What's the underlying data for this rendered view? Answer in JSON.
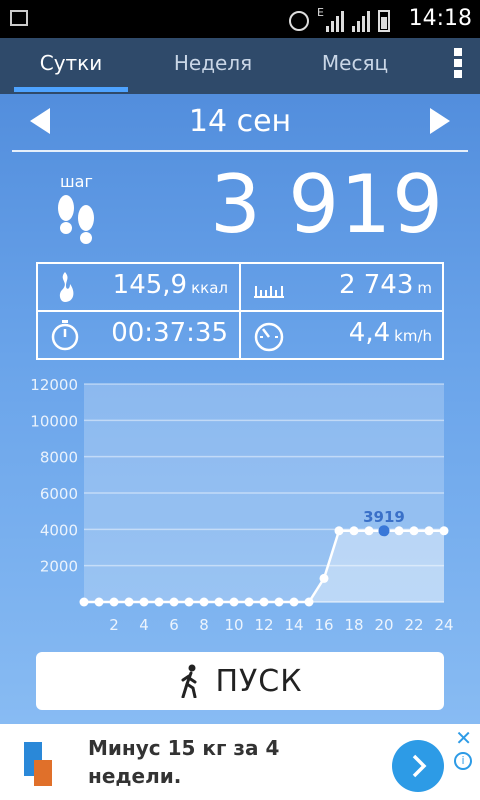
{
  "status": {
    "time": "14:18",
    "network": "E"
  },
  "tabs": [
    {
      "label": "Сутки",
      "active": true
    },
    {
      "label": "Неделя",
      "active": false
    },
    {
      "label": "Месяц",
      "active": false
    }
  ],
  "date": "14 сен",
  "steps": {
    "label": "шаг",
    "value": "3 919"
  },
  "stats": {
    "calories": {
      "value": "145,9",
      "unit": "ккал"
    },
    "distance": {
      "value": "2 743",
      "unit": "m"
    },
    "duration": {
      "value": "00:37:35"
    },
    "speed": {
      "value": "4,4",
      "unit": "km/h"
    }
  },
  "chart_data": {
    "type": "line",
    "x": [
      0,
      1,
      2,
      3,
      4,
      5,
      6,
      7,
      8,
      9,
      10,
      11,
      12,
      13,
      14,
      15,
      16,
      17,
      18,
      19,
      20,
      21,
      22,
      23,
      24
    ],
    "values": [
      0,
      0,
      0,
      0,
      0,
      0,
      0,
      0,
      0,
      0,
      0,
      0,
      0,
      0,
      0,
      0,
      1300,
      3919,
      3919,
      3919,
      3919,
      3919,
      3919,
      3919,
      3919
    ],
    "x_tick_labels": [
      "2",
      "4",
      "6",
      "8",
      "10",
      "12",
      "14",
      "16",
      "18",
      "20",
      "22",
      "24"
    ],
    "y_tick_labels": [
      "2000",
      "4000",
      "6000",
      "8000",
      "10000",
      "12000"
    ],
    "ylim": [
      0,
      12000
    ],
    "highlight": {
      "x": 20,
      "label": "3919"
    },
    "grid": true
  },
  "start_button": {
    "label": "ПУСК"
  },
  "ad": {
    "text": "Минус 15 кг за 4 недели.",
    "close": "✕",
    "info": "i"
  },
  "colors": {
    "tab_bar": "#2f4a6a",
    "accent": "#4ea3ff",
    "highlight_point": "#3a78d8"
  }
}
